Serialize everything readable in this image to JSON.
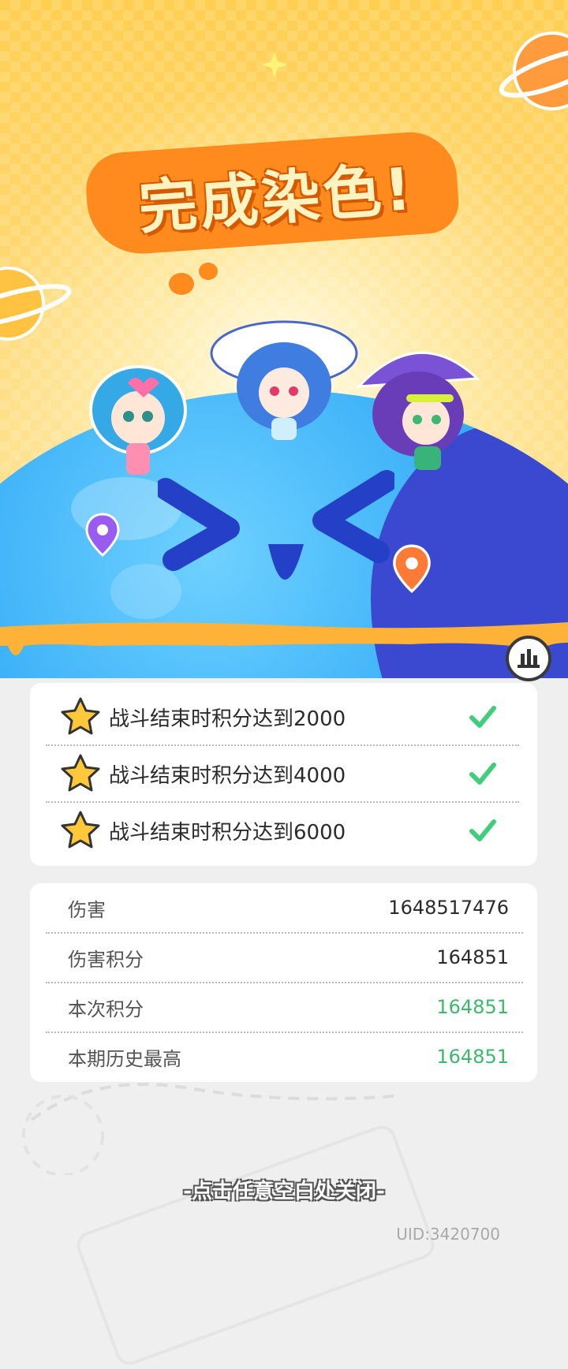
{
  "title": "完成染色!",
  "tasks": [
    {
      "label": "战斗结束时积分达到2000",
      "done": true
    },
    {
      "label": "战斗结束时积分达到4000",
      "done": true
    },
    {
      "label": "战斗结束时积分达到6000",
      "done": true
    }
  ],
  "stats": [
    {
      "label": "伤害",
      "value": "1648517476"
    },
    {
      "label": "伤害积分",
      "value": "164851"
    },
    {
      "label": "本次积分",
      "value": "164851"
    },
    {
      "label": "本期历史最高",
      "value": "164851"
    }
  ],
  "close_hint": "-点击任意空白处关闭-",
  "uid": "UID:3420700",
  "colors": {
    "accent_orange": "#ff8a1e",
    "globe_blue": "#37aef7",
    "success_green": "#3fb86d",
    "star_yellow": "#ffc83a"
  },
  "icons": {
    "task_star": "star-icon",
    "task_check": "check-icon",
    "rank": "leaderboard-icon"
  }
}
